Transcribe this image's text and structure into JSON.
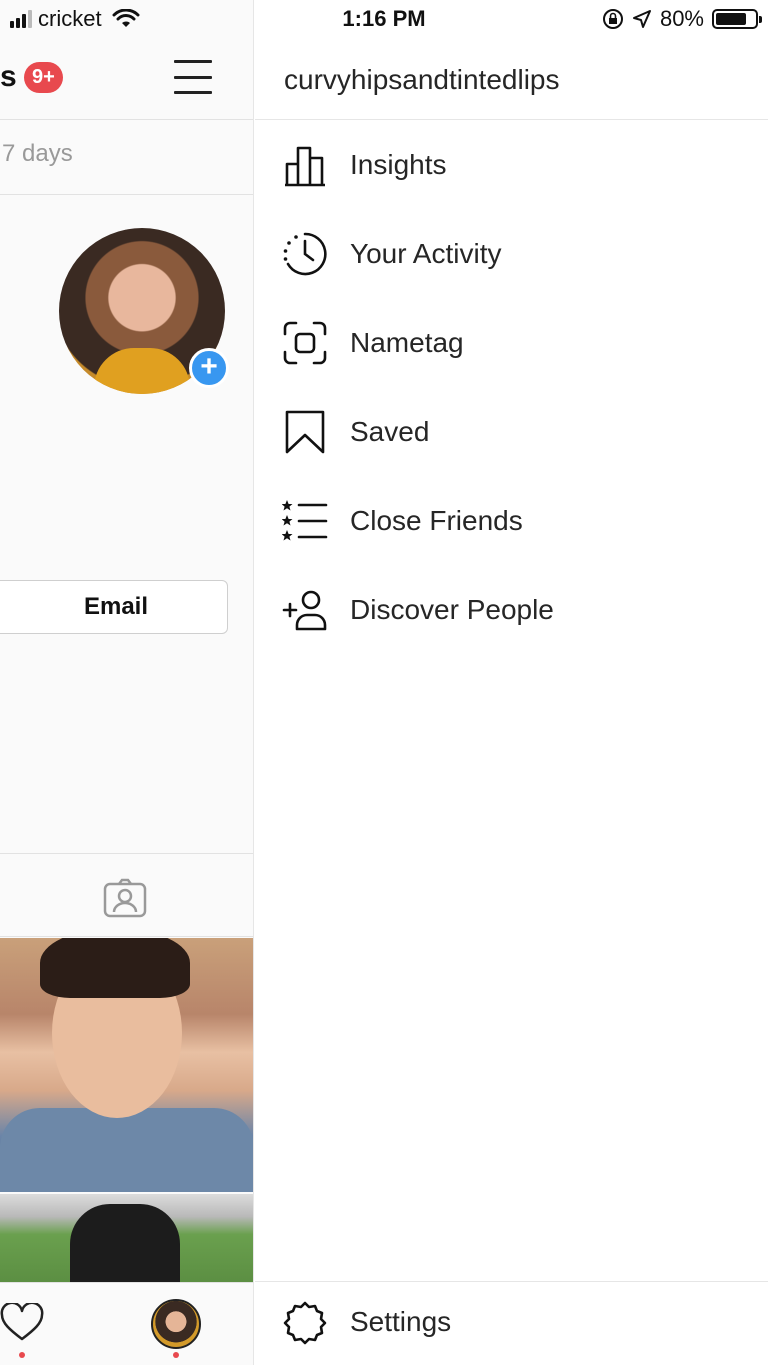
{
  "status_bar": {
    "carrier": "cricket",
    "time": "1:16 PM",
    "battery_percent": "80%",
    "battery_level": 0.8
  },
  "background_profile": {
    "title_fragment": "s",
    "notification_badge": "9+",
    "days_text": "7 days",
    "email_button": "Email"
  },
  "menu": {
    "username": "curvyhipsandtintedlips",
    "items": [
      {
        "label": "Insights",
        "icon": "bar-chart-icon"
      },
      {
        "label": "Your Activity",
        "icon": "activity-clock-icon"
      },
      {
        "label": "Nametag",
        "icon": "nametag-icon"
      },
      {
        "label": "Saved",
        "icon": "bookmark-icon"
      },
      {
        "label": "Close Friends",
        "icon": "close-friends-list-icon"
      },
      {
        "label": "Discover People",
        "icon": "add-person-icon"
      }
    ],
    "settings_label": "Settings"
  },
  "colors": {
    "badge": "#e8494e",
    "add_story": "#3897f0",
    "text": "#262626",
    "divider": "#e6e6e6"
  }
}
